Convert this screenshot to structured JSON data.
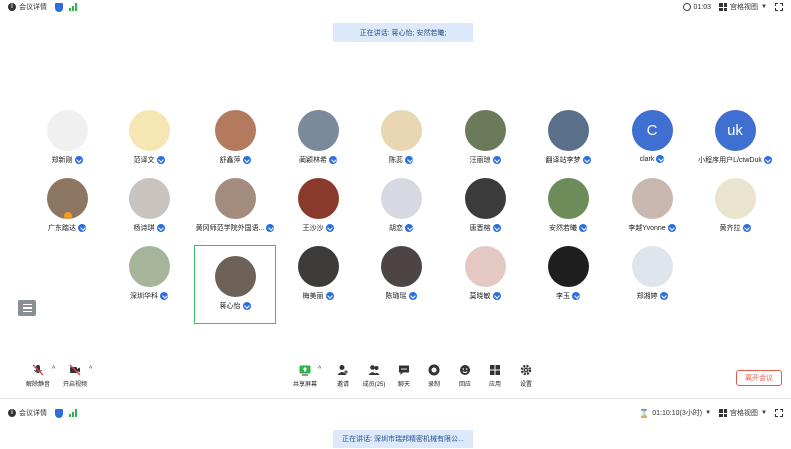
{
  "top": {
    "meeting_info": "会议详情",
    "timer": "01:03",
    "view_mode": "宫格视图"
  },
  "speaking_banner": "正在讲话: 蒋心怡; 安然若曦;",
  "participants": [
    {
      "name": "郑新刚",
      "avatar_color": "#f0f0f0",
      "initial": "",
      "verified": true
    },
    {
      "name": "范译文",
      "avatar_color": "#f6e6b4",
      "initial": "",
      "verified": true
    },
    {
      "name": "舒鑫萍",
      "avatar_color": "#b47a5e",
      "initial": "",
      "verified": true
    },
    {
      "name": "蔺颖林希",
      "avatar_color": "#7a8a9a",
      "initial": "",
      "verified": true
    },
    {
      "name": "陈蕊",
      "avatar_color": "#e9d6b2",
      "initial": "",
      "verified": true
    },
    {
      "name": "汪丽琼",
      "avatar_color": "#6b7b5a",
      "initial": "",
      "verified": true
    },
    {
      "name": "翻译站李梦",
      "avatar_color": "#5a6f8a",
      "initial": "",
      "verified": true
    },
    {
      "name": "clark",
      "avatar_color": "#3f6fd1",
      "initial": "C",
      "verified": true
    },
    {
      "name": "小程序用户L/ctwDuk",
      "avatar_color": "#3f6fd1",
      "initial": "uk",
      "verified": true
    },
    {
      "name": "广东踏达",
      "avatar_color": "#8d7763",
      "initial": "",
      "verified": true,
      "host": true
    },
    {
      "name": "杨诗琪",
      "avatar_color": "#c9c4c0",
      "initial": "",
      "verified": true
    },
    {
      "name": "黄冈师范学院外国语...",
      "avatar_color": "#a38c7e",
      "initial": "",
      "verified": true
    },
    {
      "name": "王沙沙",
      "avatar_color": "#8a3a2a",
      "initial": "",
      "verified": true
    },
    {
      "name": "胡恋",
      "avatar_color": "#d8d8e2",
      "initial": "",
      "verified": true
    },
    {
      "name": "唐晋榕",
      "avatar_color": "#3b3b3b",
      "initial": "",
      "verified": true
    },
    {
      "name": "安然若曦",
      "avatar_color": "#6c8c5a",
      "initial": "",
      "verified": true
    },
    {
      "name": "李越Yvonne",
      "avatar_color": "#c8b8b0",
      "initial": "",
      "verified": true
    },
    {
      "name": "黄齐拉",
      "avatar_color": "#e8e4cf",
      "initial": "",
      "verified": true
    },
    {
      "name": "深圳华科",
      "avatar_color": "#a6b59a",
      "initial": "",
      "verified": true
    },
    {
      "name": "蒋心怡",
      "avatar_color": "#6e6258",
      "initial": "",
      "verified": true,
      "active": true
    },
    {
      "name": "梅美丽",
      "avatar_color": "#3d3a3a",
      "initial": "",
      "verified": true
    },
    {
      "name": "陈璐瑶",
      "avatar_color": "#4d4545",
      "initial": "",
      "verified": true
    },
    {
      "name": "莫晓敏",
      "avatar_color": "#e4c8c4",
      "initial": "",
      "verified": true
    },
    {
      "name": "李玉",
      "avatar_color": "#1f1f1f",
      "initial": "",
      "verified": true
    },
    {
      "name": "郑湘婷",
      "avatar_color": "#dfe5ec",
      "initial": "",
      "verified": true
    }
  ],
  "toolbar": {
    "unmute": "解除静音",
    "start_video": "开启视频",
    "share_screen": "共享屏幕",
    "invite": "邀请",
    "members": "成员(25)",
    "chat": "聊天",
    "record": "录制",
    "reactions": "回应",
    "apps": "应用",
    "settings": "设置",
    "leave": "离开会议"
  },
  "bottom": {
    "meeting_info": "会议详情",
    "timer": "01:10:10(3小时)",
    "view_mode": "宫格视图"
  },
  "speaking_banner_2": "正在讲话: 深圳市瑞邦精密机械有限公..."
}
